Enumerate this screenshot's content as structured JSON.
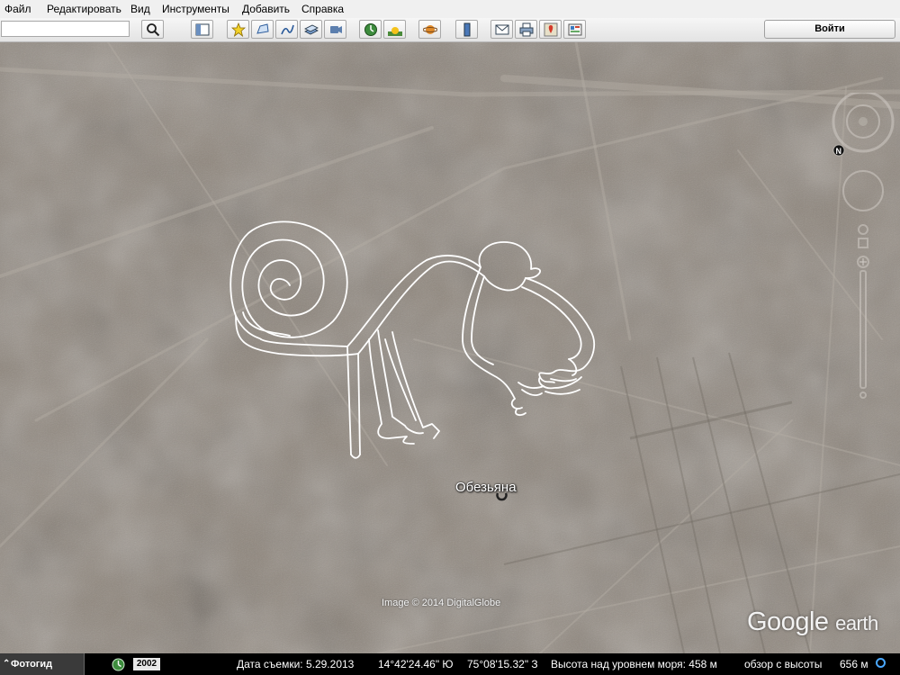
{
  "menu": {
    "items": [
      "Файл",
      "Редактировать",
      "Вид",
      "Инструменты",
      "Добавить",
      "Справка"
    ]
  },
  "toolbar": {
    "search_value": "",
    "login_label": "Войти"
  },
  "map": {
    "place_label": "Обезьяна",
    "copyright": "Image © 2014 DigitalGlobe",
    "logo_google": "Google",
    "logo_earth": "earth",
    "north_label": "N"
  },
  "status": {
    "tour_label": "Фотогид",
    "year": "2002",
    "date": "Дата съемки: 5.29.2013",
    "lat": "14°42'24.46\" Ю",
    "lon": "75°08'15.32\" З",
    "elevation": "Высота над уровнем моря:  458 м",
    "eye_alt": "обзор с высоты",
    "eye_alt_value": "656 м"
  },
  "colors": {
    "ground": "#8e857b",
    "geoglyph_line": "#ffffff",
    "status_ring": "#4aa8ff"
  },
  "icons": [
    "search-icon",
    "sidebar-icon",
    "placemark-icon",
    "polygon-icon",
    "path-icon",
    "overlay-icon",
    "record-tour-icon",
    "historical-imagery-icon",
    "sunlight-icon",
    "planet-icon",
    "ruler-icon",
    "email-icon",
    "print-icon",
    "google-maps-icon",
    "kml-icon"
  ]
}
